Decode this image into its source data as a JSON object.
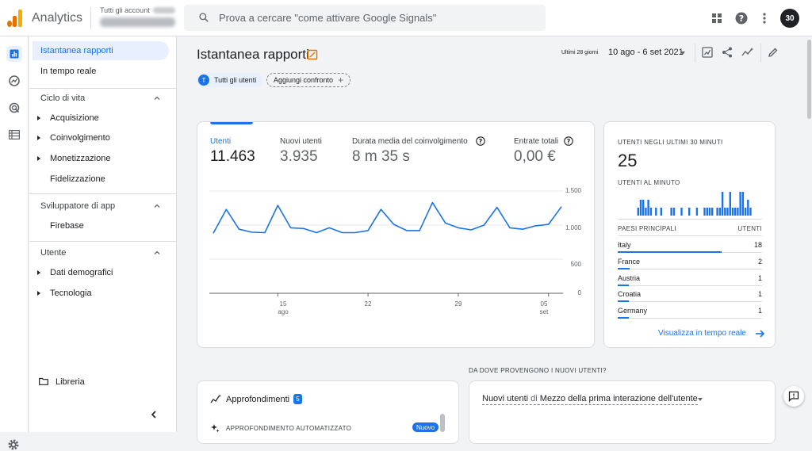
{
  "header": {
    "app_name": "Analytics",
    "account_label": "Tutti gli account",
    "search_placeholder": "Prova a cercare \"come attivare Google Signals\"",
    "avatar_text": "30"
  },
  "sidebar": {
    "items": {
      "snapshot": "Istantanea rapporti",
      "realtime": "In tempo reale",
      "lifecycle": "Ciclo di vita",
      "acquisition": "Acquisizione",
      "engagement": "Coinvolgimento",
      "monetization": "Monetizzazione",
      "retention": "Fidelizzazione",
      "app_dev": "Sviluppatore di app",
      "firebase": "Firebase",
      "user": "Utente",
      "demographics": "Dati demografici",
      "technology": "Tecnologia",
      "library": "Libreria"
    }
  },
  "toolbar": {
    "title": "Istantanea rapporti",
    "date_badge": "Ultimi 28 giorni",
    "date_range": "10 ago - 6 set 2021"
  },
  "chips": {
    "all_users": "Tutti gli utenti",
    "all_users_letter": "T",
    "add_compare": "Aggiungi confronto",
    "plus": "+"
  },
  "metrics": [
    {
      "label": "Utenti",
      "value": "11.463"
    },
    {
      "label": "Nuovi utenti",
      "value": "3.935"
    },
    {
      "label": "Durata media del coinvolgimento",
      "value": "8 m 35 s"
    },
    {
      "label": "Entrate totali",
      "value": "0,00 €"
    }
  ],
  "chart_data": {
    "type": "line",
    "y_ticks": [
      "1.500",
      "1.000",
      "500",
      "0"
    ],
    "ylim": [
      0,
      1500
    ],
    "x_ticks": [
      {
        "day": "15",
        "month": "ago"
      },
      {
        "day": "22",
        "month": ""
      },
      {
        "day": "29",
        "month": ""
      },
      {
        "day": "05",
        "month": "set"
      }
    ],
    "x_tick_indices": [
      5,
      12,
      19,
      26
    ],
    "series": [
      {
        "values": [
          880,
          1230,
          940,
          895,
          890,
          1290,
          960,
          950,
          890,
          960,
          890,
          890,
          920,
          1230,
          1010,
          920,
          920,
          1330,
          1030,
          960,
          930,
          1000,
          1260,
          960,
          940,
          990,
          1010,
          1270
        ]
      }
    ]
  },
  "realtime": {
    "title": "UTENTI NEGLI ULTIMI 30 MINUTI",
    "value": "25",
    "per_minute_label": "UTENTI AL MINUTO",
    "per_minute": [
      0,
      0,
      0,
      0,
      0,
      0,
      0,
      1,
      2,
      2,
      1,
      2,
      1,
      0,
      1,
      0,
      1,
      0,
      0,
      0,
      1,
      1,
      0,
      0,
      1,
      0,
      0,
      1,
      0,
      0,
      1,
      0,
      0,
      1,
      1,
      1,
      1,
      0,
      1,
      1,
      3,
      1,
      1,
      3,
      1,
      1,
      1,
      3,
      3,
      1,
      2,
      1,
      0,
      0
    ],
    "countries_head": "PAESI PRINCIPALI",
    "users_head": "UTENTI",
    "rows": [
      {
        "country": "Italy",
        "users": "18",
        "share": 0.72
      },
      {
        "country": "France",
        "users": "2",
        "share": 0.08
      },
      {
        "country": "Austria",
        "users": "1",
        "share": 0.04
      },
      {
        "country": "Croatia",
        "users": "1",
        "share": 0.04
      },
      {
        "country": "Germany",
        "users": "1",
        "share": 0.04
      }
    ],
    "link": "Visualizza in tempo reale"
  },
  "bottom": {
    "where_title": "DA DOVE PROVENGONO I NUOVI UTENTI?",
    "insights_title": "Approfondimenti",
    "insights_count": "5",
    "auto_title": "APPROFONDIMENTO AUTOMATIZZATO",
    "new_badge": "Nuovo",
    "acq_title_a": "Nuovi utenti",
    "acq_title_b": " di ",
    "acq_title_c": "Mezzo della prima interazione dell'utente"
  },
  "colors": {
    "accent": "#1a73e8",
    "logo_orange": "#f9ab00",
    "logo_dark_orange": "#e37400"
  }
}
